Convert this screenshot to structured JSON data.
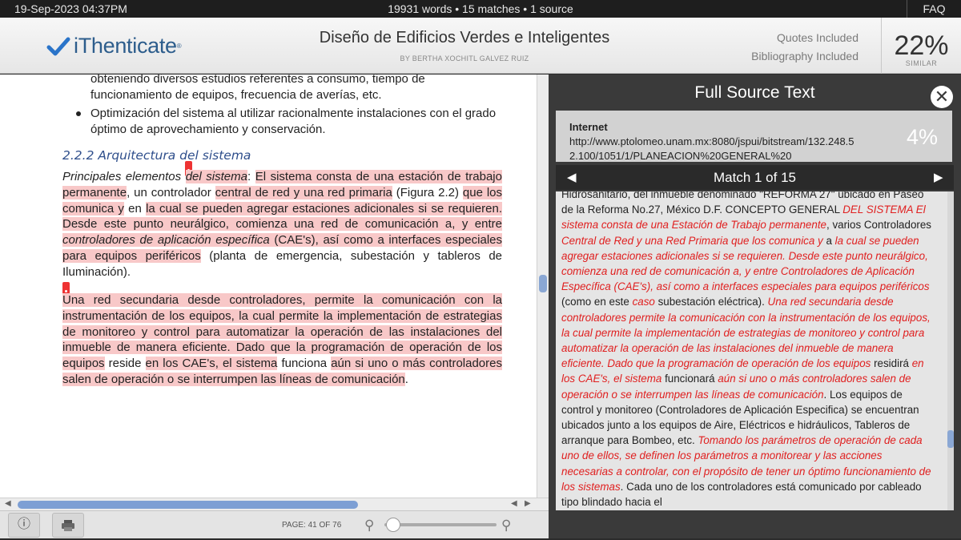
{
  "topbar": {
    "datetime": "19-Sep-2023 04:37PM",
    "summary": "19931 words • 15 matches • 1 source",
    "faq": "FAQ"
  },
  "header": {
    "logo_text": "iThenticate",
    "logo_mark": "®",
    "doc_title": "Diseño de Edificios Verdes e Inteligentes",
    "doc_author": "BY BERTHA XOCHITL GALVEZ RUIZ",
    "quotes": "Quotes Included",
    "bibliography": "Bibliography Included",
    "similar_pct": "22%",
    "similar_label": "SIMILAR"
  },
  "document": {
    "line1": "obteniendo diversos estudios referentes a consumo, tiempo de",
    "line2": "funcionamiento de equipos, frecuencia de averías, etc.",
    "bullet_line1": "Optimización del sistema al utilizar racionalmente instalaciones con el grado",
    "bullet_line2": "óptimo de aprovechamiento y conservación.",
    "heading": "2.2.2 Arquitectura del sistema",
    "p1": {
      "a": "Principales elementos ",
      "b": "del sistema",
      "c": ": ",
      "d": "El sistema consta de una estación de trabajo permanente",
      "e": ", un controlador ",
      "f": "central de red y una red primaria",
      "g": " (Figura 2.2) ",
      "h": "que los comunica y",
      "i": " en ",
      "j": "la cual se pueden agregar estaciones adicionales si se requieren. Desde este punto neurálgico, comienza una red de comunicación a, y entre ",
      "k": "controladores de aplicación específica",
      "l": " (CAE's), así como a interfaces especiales para equipos periféricos",
      "m": " (planta de emergencia, subestación y tableros de Iluminación)."
    },
    "p2": {
      "a": "Una red secundaria desde controladores, permite la comunicación con la instrumentación de los equipos, la cual permite la implementación de estrategias de monitoreo y control para automatizar la operación de las instalaciones del inmueble de manera eficiente. Dado que la programación de operación de los equipos",
      "b": " reside ",
      "c": "en los CAE's, el sistema",
      "d": " funciona ",
      "e": "aún si uno o más controladores salen de operación o se interrumpen las líneas de comunicación",
      "f": "."
    }
  },
  "bottom": {
    "page_label": "PAGE: 41 OF 76"
  },
  "source": {
    "title": "Full Source Text",
    "type": "Internet",
    "url": "http://www.ptolomeo.unam.mx:8080/jspui/bitstream/132.248.52.100/1051/1/PLANEACION%20GENERAL%20",
    "pct": "4%",
    "match_label": "Match 1 of 15",
    "t1": "Hidrosanitario, del inmueble denominado \"REFORMA 27\" ubicado en Paseo de la Reforma No.27, México D.F. CONCEPTO GENERAL ",
    "m1": "DEL SISTEMA El sistema consta de una Estación de Trabajo permanente",
    "t2": ", varios Controladores ",
    "m2": "Central de Red y una Red Primaria que los comunica y",
    "t3": " a ",
    "m3": "la cual se pueden agregar estaciones adicionales si se requieren. Desde este punto neurálgico, comienza una red de comunicación a, y entre Controladores de Aplicación Específica (CAE's), así como a interfaces especiales para equipos periféricos",
    "t4": " (como en este ",
    "m4": "caso",
    "t5": " subestación eléctrica). ",
    "m5": "Una red secundaria desde controladores permite la comunicación con la instrumentación de los equipos, la cual permite la implementación de estrategias de monitoreo y control para automatizar la operación de las instalaciones del inmueble de manera eficiente. Dado que la programación de operación de los equipos",
    "t6": " residirá ",
    "m6": "en los CAE's, el sistema",
    "t7": " funcionará ",
    "m7": "aún si uno o más controladores salen de operación o se interrumpen las líneas de comunicación",
    "t8": ". Los equipos de control y monitoreo (Controladores de Aplicación Especifica) se encuentran ubicados junto a los equipos de Aire, Eléctricos e hidráulicos, Tableros de arranque para Bombeo, etc. ",
    "m8": "Tomando los parámetros de operación de cada uno de ellos, se definen los parámetros a monitorear y las acciones necesarias a controlar, con el propósito de tener un óptimo funcionamiento de los sistemas",
    "t9": ". Cada uno de los controladores está comunicado por cableado tipo blindado hacia el"
  },
  "colors": {
    "highlight": "#f8c8c8",
    "match_text": "#e02020",
    "logo_blue": "#2d5d8c",
    "heading_blue": "#2f4f8c"
  }
}
